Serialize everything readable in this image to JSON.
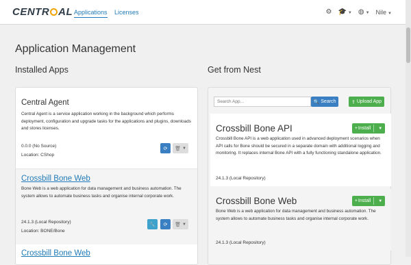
{
  "brand": {
    "logo_text_a": "CENTR",
    "logo_text_b": "AL"
  },
  "nav": {
    "applications": "Applications",
    "licenses": "Licenses",
    "user": "Nile"
  },
  "page": {
    "title": "Application Management"
  },
  "installed": {
    "heading": "Installed Apps",
    "apps": [
      {
        "title": "Central Agent",
        "description": "Central Agent is a service application working in the background which performs deployment, configuration and upgrade tasks for the applications and plugins, downloads and stores licenses.",
        "version": "0.0.0 (No Source)",
        "location": "Location: CShop"
      },
      {
        "title": "Crossbill Bone Web",
        "description": "Bone Web is a web application for data management and business automation. The system allows to automate business tasks and organise internal corporate work.",
        "version": "24.1.3 (Local Repository)",
        "location": "Location: BONE/Bone"
      },
      {
        "title": "Crossbill Bone Web"
      }
    ]
  },
  "nest": {
    "heading": "Get from Nest",
    "search_placeholder": "Search App...",
    "search_button": "Search",
    "upload_button": "Upload App",
    "install_label": "Install",
    "apps": [
      {
        "title": "Crossbill Bone API",
        "description": "Crossbill Bone API is a web application used in advanced deployment scenarios when API calls for Bone should be secured in a separate domain with additional logging and monitoring. It replaces internal Bone API with a fully functioning standalone application.",
        "version": "24.1.3 (Local Repository)"
      },
      {
        "title": "Crossbill Bone Web",
        "description": "Bone Web is a web application for data management and business automation. The system allows to automate business tasks and organise internal corporate work.",
        "version": "24.1.3 (Local Repository)"
      }
    ]
  },
  "colors": {
    "accent": "#1f7ab6",
    "green": "#4cae4c",
    "logo_ring": "#f0a300"
  },
  "icons": [
    "gear-icon",
    "graduation-cap-icon",
    "globe-icon",
    "refresh-icon",
    "trash-icon",
    "wrench-icon",
    "search-icon",
    "upload-icon",
    "plus-icon"
  ]
}
